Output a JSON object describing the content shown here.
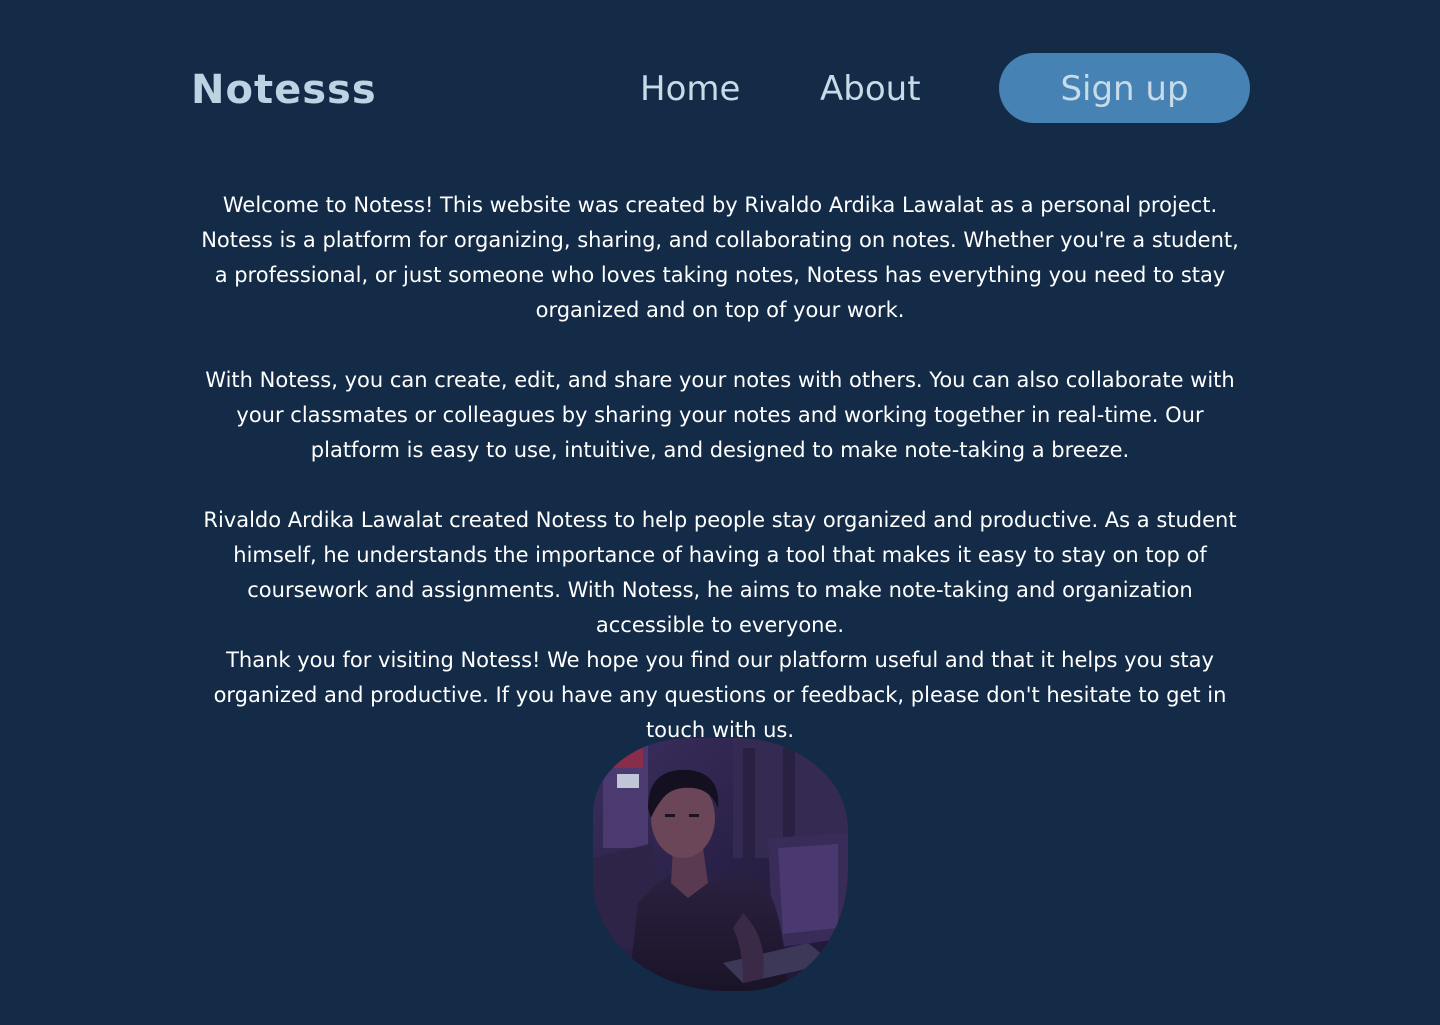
{
  "nav": {
    "brand": "Notesss",
    "home": "Home",
    "about": "About",
    "signup": "Sign up"
  },
  "about": {
    "paragraphs": [
      "Welcome to Notess! This website was created by Rivaldo Ardika Lawalat as a personal project. Notess is a platform for organizing, sharing, and collaborating on notes. Whether you're a student, a professional, or just someone who loves taking notes, Notess has everything you need to stay organized and on top of your work.",
      "With Notess, you can create, edit, and share your notes with others. You can also collaborate with your classmates or colleagues by sharing your notes and working together in real-time. Our platform is easy to use, intuitive, and designed to make note-taking a breeze.",
      "Rivaldo Ardika Lawalat created Notess to help people stay organized and productive. As a student himself, he understands the importance of having a tool that makes it easy to stay on top of coursework and assignments. With Notess, he aims to make note-taking and organization accessible to everyone.",
      "Thank you for visiting Notess! We hope you find our platform useful and that it helps you stay organized and productive. If you have any questions or feedback, please don't hesitate to get in touch with us."
    ]
  },
  "colors": {
    "background": "#132b47",
    "brand": "#bcd3e3",
    "button": "#4682b4",
    "text": "#ffffff"
  }
}
